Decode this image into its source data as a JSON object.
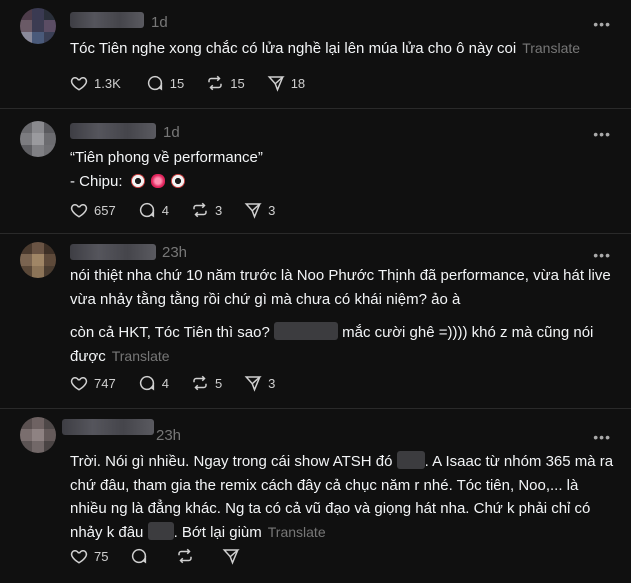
{
  "posts": [
    {
      "time": "1d",
      "text": "Tóc Tiên nghe xong chắc có lửa nghề lại lên múa lửa cho ô này coi",
      "translate": "Translate",
      "likes": "1.3K",
      "replies": "15",
      "reposts": "15",
      "shares": "18"
    },
    {
      "time": "1d",
      "line1": "“Tiên phong về performance”",
      "line2": "- Chipu:",
      "emoji": [
        "eye-emoji",
        "lips-emoji",
        "eye-emoji"
      ],
      "likes": "657",
      "replies": "4",
      "reposts": "3",
      "shares": "3"
    },
    {
      "time": "23h",
      "para1": "nói thiệt nha chứ 10 năm trước là Noo Phước Thịnh đã performance, vừa hát live vừa nhảy tằng tằng rồi chứ gì mà chưa có khái niệm? ảo à",
      "para2_start": "còn cả HKT, Tóc Tiên thì sao?",
      "para2_end": "mắc cười ghê =)))) khó z mà cũng nói được",
      "translate": "Translate",
      "likes": "747",
      "replies": "4",
      "reposts": "5",
      "shares": "3"
    },
    {
      "time": "23h",
      "part1": "Trời. Nói gì nhiều. Ngay trong cái show ATSH đó",
      "part2": ". A Isaac từ nhóm 365 mà ra chứ đâu, tham gia the remix cách đây cả chục năm r nhé. Tóc tiên, Noo,... là nhiều ng là đẳng khác. Ng ta có cả vũ đạo và giọng hát nha. Chứ k phải chỉ có nhảy k đâu",
      "part3": ". Bớt lại giùm",
      "translate": "Translate",
      "likes": "75"
    }
  ],
  "more_label": "•••"
}
